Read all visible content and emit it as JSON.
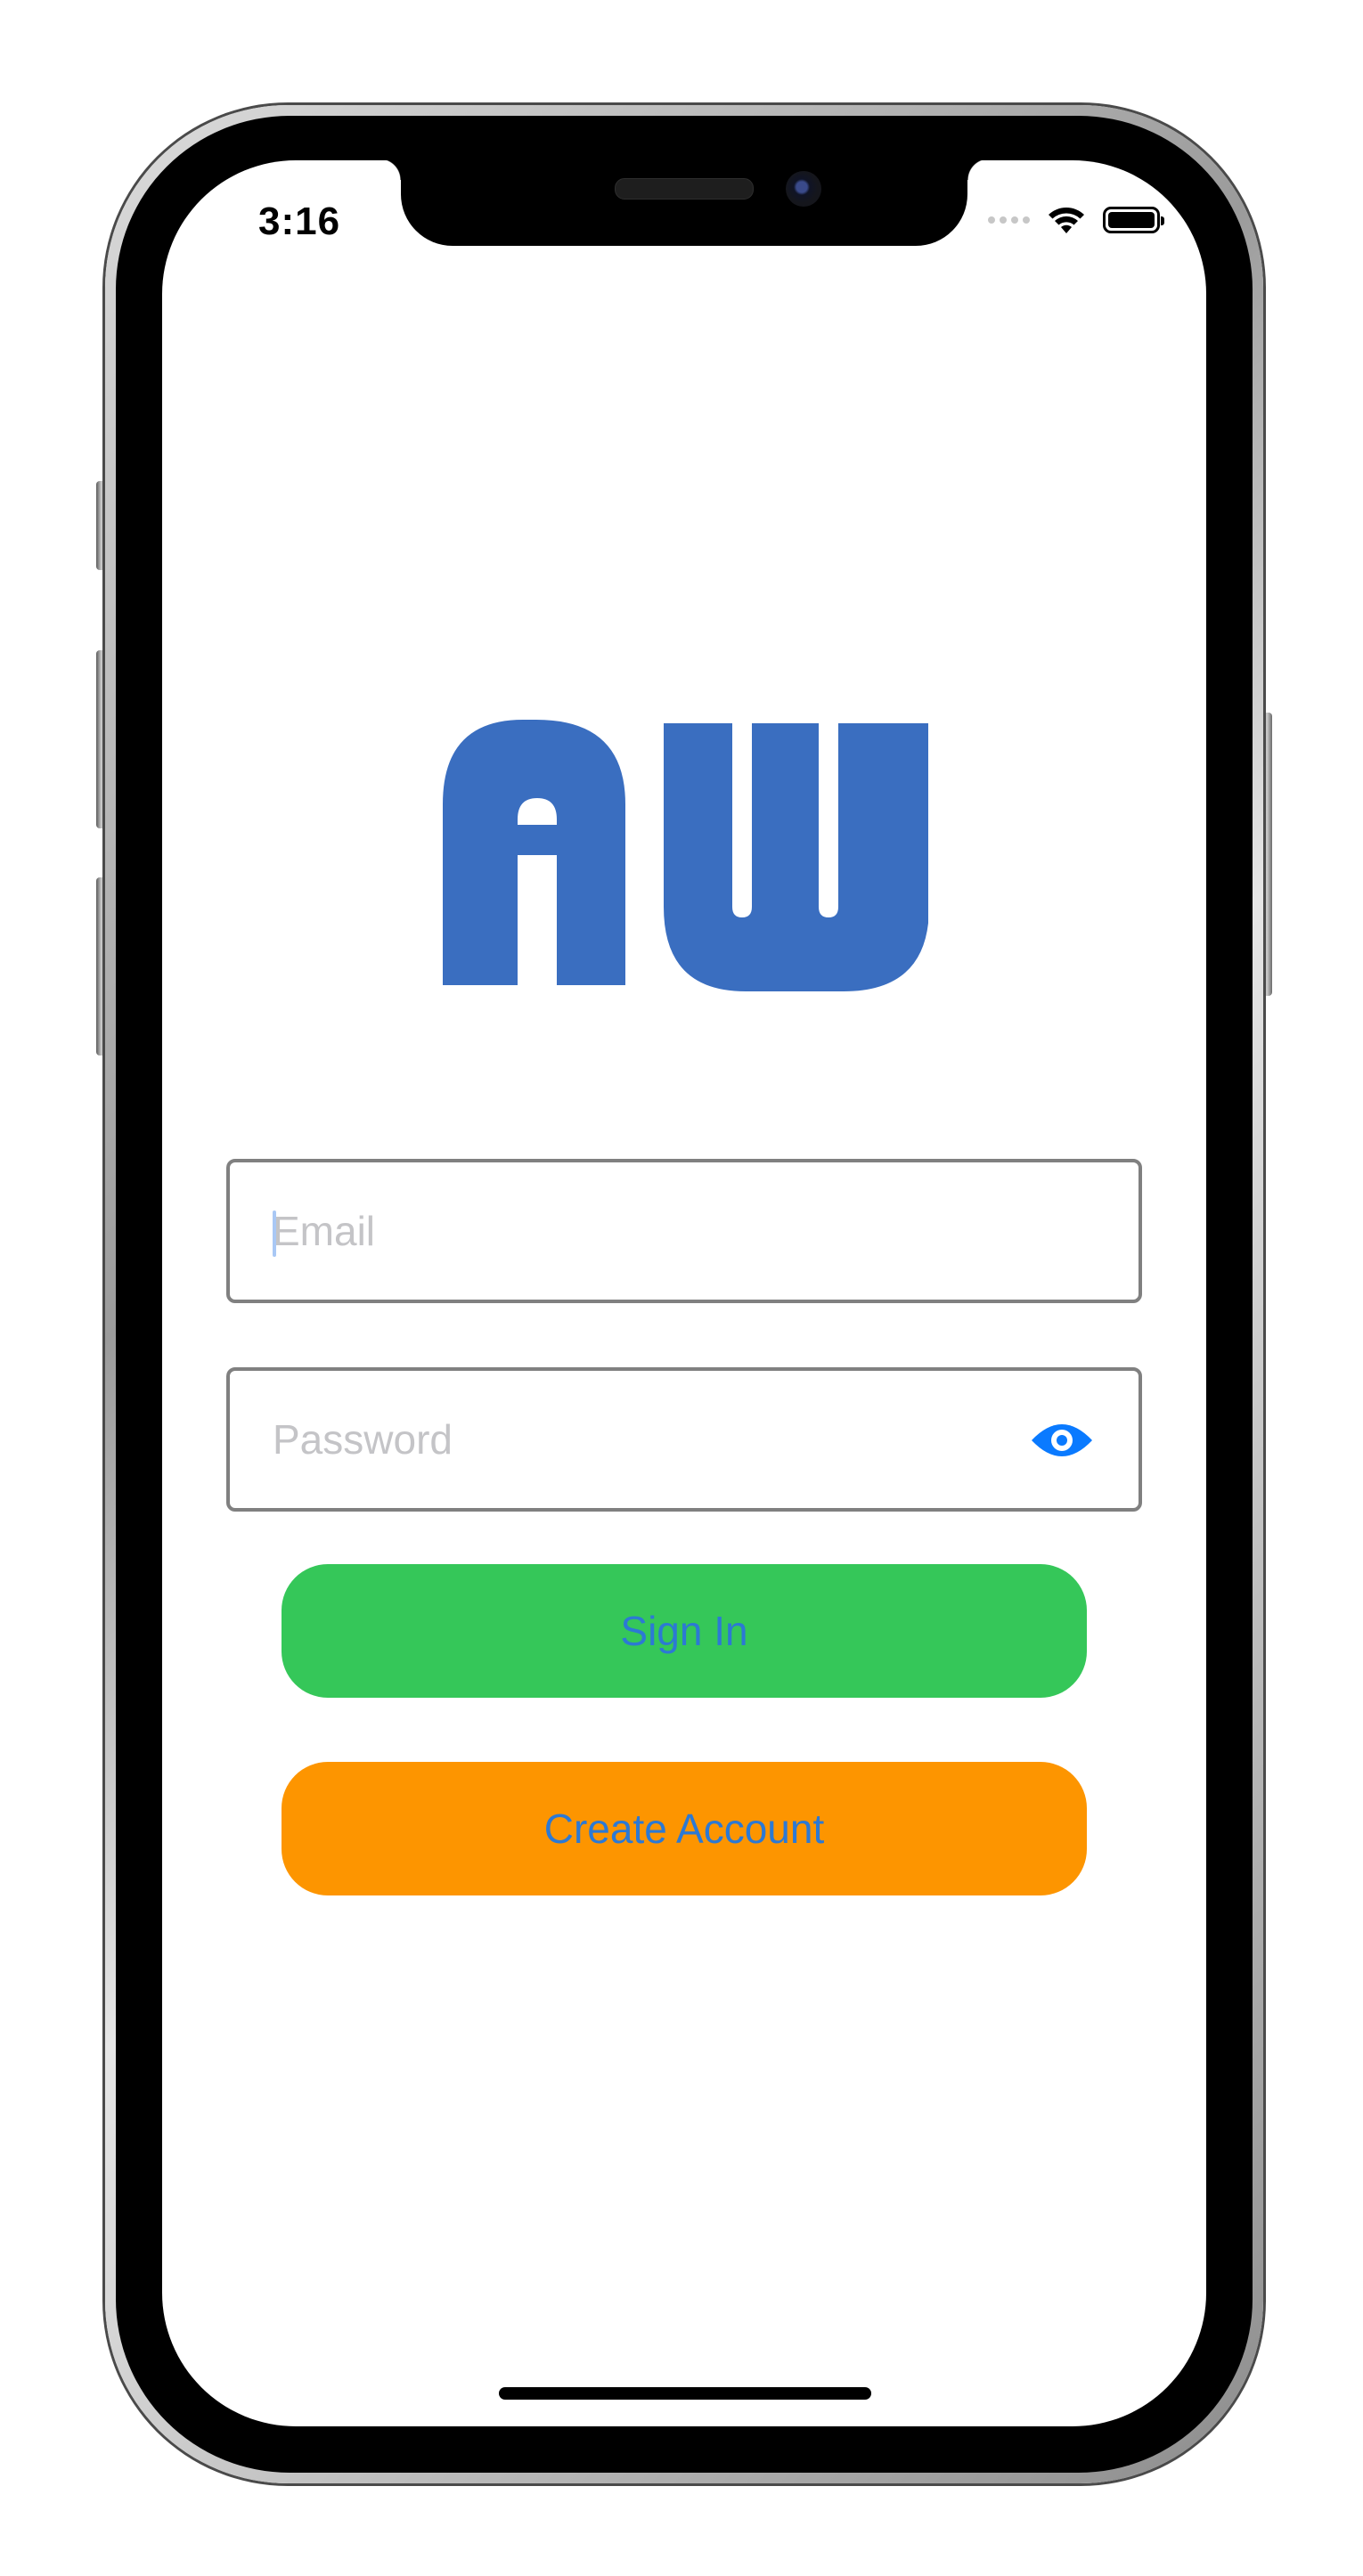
{
  "status_bar": {
    "time": "3:16"
  },
  "logo": {
    "text": "AW",
    "color": "#3a6ec0"
  },
  "email_field": {
    "value": "",
    "placeholder": "Email"
  },
  "password_field": {
    "value": "",
    "placeholder": "Password",
    "toggle_icon": "eye-icon",
    "toggle_color": "#0a7aff"
  },
  "sign_in_button": {
    "label": "Sign In",
    "bg_color": "#35c759"
  },
  "create_account_button": {
    "label": "Create Account",
    "bg_color": "#fd9500"
  },
  "colors": {
    "button_text": "#2c79d4",
    "field_border": "#808080",
    "placeholder": "#c4c4c7"
  }
}
